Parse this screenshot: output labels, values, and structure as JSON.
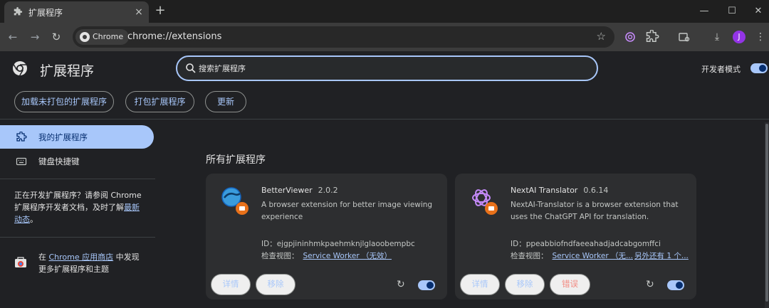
{
  "browser": {
    "tab_title": "扩展程序",
    "tab_close": "×",
    "new_tab": "+",
    "window_controls": [
      "—",
      "☐",
      "✕"
    ],
    "chip_label": "Chrome",
    "url": "chrome://extensions",
    "avatar_letter": "J",
    "icons": [
      "extensions-puzzle-icon",
      "back-icon",
      "forward-icon",
      "reload-icon",
      "bookmark-star-icon",
      "chatgpt-extension-icon",
      "extensions-icon",
      "media-controls-icon",
      "downloads-icon",
      "profile-avatar",
      "menu-kebab-icon"
    ]
  },
  "header": {
    "title": "扩展程序",
    "search_placeholder": "搜索扩展程序",
    "dev_mode_label": "开发者模式",
    "dev_mode_enabled": true
  },
  "actions": {
    "load_unpacked": "加载未打包的扩展程序",
    "pack": "打包扩展程序",
    "update": "更新"
  },
  "sidebar": {
    "items": [
      {
        "label": "我的扩展程序",
        "icon": "extensions-icon",
        "active": true
      },
      {
        "label": "键盘快捷键",
        "icon": "keyboard-icon",
        "active": false
      }
    ],
    "dev_note_pre": "正在开发扩展程序？请参阅 Chrome 扩展程序开发者文档，及时了解",
    "dev_note_link": "最新动态",
    "dev_note_post": "。",
    "store_pre": "在 ",
    "store_link": "Chrome 应用商店",
    "store_post": " 中发现更多扩展程序和主题"
  },
  "main": {
    "section_title": "所有扩展程序",
    "extensions": [
      {
        "name": "BetterViewer",
        "version": "2.0.2",
        "description": "A browser extension for better image viewing experience",
        "id_label": "ID：",
        "id": "ejgpjininhmkpaehmknjlglaoobempbc",
        "inspect_label": "检查视图：",
        "inspect_link": "Service Worker （无效）",
        "details": "详情",
        "remove": "移除",
        "enabled": true,
        "icon": "betterviewer-icon"
      },
      {
        "name": "NextAI Translator",
        "version": "0.6.14",
        "description": "NextAI-Translator is a browser extension that uses the ChatGPT API for translation.",
        "id_label": "ID：",
        "id": "ppeabbiofndfaeeahadjadcabgomffci",
        "inspect_label": "检查视图：",
        "inspect_link": "Service Worker （无...",
        "inspect_more": "另外还有 1 个...",
        "details": "详情",
        "remove": "移除",
        "errors": "错误",
        "enabled": true,
        "icon": "openai-logo-icon"
      }
    ]
  },
  "colors": {
    "accent": "#a8c7fa",
    "background": "#202124",
    "card": "#2d2e30",
    "error": "#f28b82"
  }
}
